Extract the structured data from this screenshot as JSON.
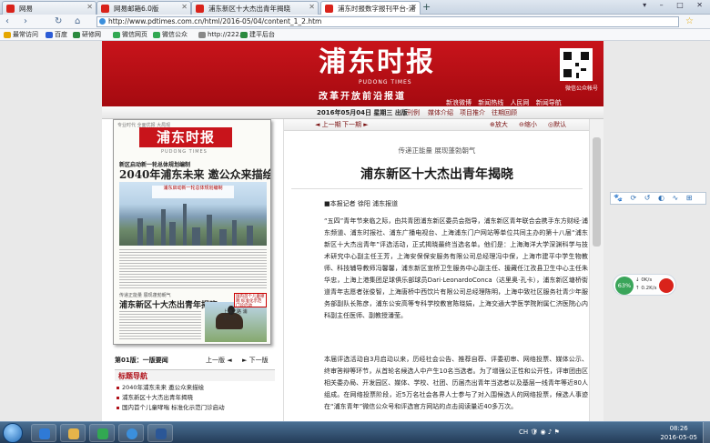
{
  "browser": {
    "tabs": [
      {
        "label": "网易",
        "active": false
      },
      {
        "label": "网易邮箱6.0版",
        "active": false
      },
      {
        "label": "浦东新区十大杰出青年揭晓",
        "active": false
      },
      {
        "label": "浦东时报数字报刊平台-浦",
        "active": true
      }
    ],
    "new_tab": "+",
    "window_buttons": "▾ – □ ✕",
    "nav": {
      "back": "‹",
      "forward": "›",
      "reload": "↻",
      "home": "⌂"
    },
    "url": "http://www.pdtimes.com.cn/html/2016-05/04/content_1_2.htm",
    "bookmarks": [
      {
        "label": "最常访问",
        "color": "#e5a700"
      },
      {
        "label": "百度",
        "color": "#2c5cd6"
      },
      {
        "label": "研修网",
        "color": "#2b8a3e"
      },
      {
        "label": "微信网页",
        "color": "#32a852"
      },
      {
        "label": "微信公众",
        "color": "#32a852"
      },
      {
        "label": "http://222.",
        "color": "#888888"
      },
      {
        "label": "建平后台",
        "color": "#2b8a3e"
      }
    ]
  },
  "masthead": {
    "logo": "浦东时报",
    "sub": "PUDONG TIMES",
    "slogan": "改革开放前沿报道",
    "qr_label": "微信公众帐号",
    "links": [
      "新浪微博",
      "新闻热线",
      "人民网",
      "新闻导航"
    ]
  },
  "datebar": {
    "date": "2016年05月04日",
    "weekday": "星期三",
    "label": "出版",
    "links": [
      "刊例",
      "媒体介绍",
      "项目推介",
      "往期回顾"
    ]
  },
  "paper_thumb": {
    "top_text": "专业时代 全面优报 大局观",
    "logo": "浦东时报",
    "times": "PUDONG TIMES",
    "headline_sub": "新区启动新一轮总体规划编制",
    "headline": "2040年浦东未来 邀公众来描绘",
    "photo_caption": "浦东启动新一轮总体规划编制",
    "headline2_sub": "传递正能量 展现蓬勃朝气",
    "headline2": "浦东新区十大杰出青年揭晓",
    "right_box": "国内首个儿童哮喘 标准化示范门诊启动",
    "ad_text": "上海之路 浦东之光"
  },
  "pager": {
    "page_label": "第01版：一版要闻",
    "prev": "上一版 ◄",
    "next": "► 下一版"
  },
  "nav_section": {
    "title": "标题导航",
    "items": [
      "2040年浦东未来 邀公众来描绘",
      "浦东新区十大杰出青年揭晓",
      "国内首个儿童哮喘 标准化示范门诊启动"
    ]
  },
  "article": {
    "toolbar": {
      "prev": "上一期",
      "next": "下一期",
      "zoom_in": "放大",
      "zoom_out": "缩小",
      "default": "默认"
    },
    "kicker": "传递正能量 展现蓬勃朝气",
    "headline": "浦东新区十大杰出青年揭晓",
    "byline": "■本报记者 徐阳 浦东报道",
    "paragraph1": "“五四”青年节来临之际，由共青团浦东新区委员会指导，浦东新区青年联合会携手东方财经·浦东频道、浦东时报社、浦东广播电视台、上海浦东门户网站等单位共同主办的第十八届“浦东新区十大杰出青年”评选活动，正式揭晓最终当选名单。他们是：上海海洋大学深渊科学与技术研究中心副主任王芳，上海安保保安服务有限公司总经理冯中保，上海市建平中学生物教师、科技辅导教师冯馨馨，浦东新区宣桥卫生服务中心副主任、援藏任江孜县卫生中心主任朱华忠，上海上港集团足球俱乐部球员Dari·LeonardoConca（达里奥·孔卡），浦东新区塘桥街道青年志愿者张俊智，上海唐桥中西饮片有限公司总经理陈明，上海中致社区服务社青少年服务部副队长陈彦，浦东公安高等专科学校教官陈晓娟，上海交通大学医学院附属仁济医院心内科副主任医师、副教授潘莹。",
    "paragraph2": "本届评选活动自3月启动以来，历经社会公告、推荐自荐、评委初审、网络投票、媒体公示、终审答辩等环节，从首轮名候选人中产生10名当选者。为了增强公正性和公开性，评审团由区相关委办局、开发园区、媒体、学校、社团、历届杰出青年当选者以及基层一线青年等近80人组成。在网络投票阶段，近5万名社会各界人士参与了对入围候选人的网络投票，候选人事迹在“浦东青年”微信公众号和评选官方网站的点击阅读量近40多万次。"
  },
  "floatbar": "🐾 ⟳ ↺ ◐ ∿ ⊞",
  "network_widget": {
    "percent": "63%",
    "down": "0K/s",
    "up": "0.2K/s"
  },
  "taskbar": {
    "tray": "CH 🛡 ◉ ♪ ⚑",
    "time": "08:26",
    "date": "2016-05-05"
  }
}
